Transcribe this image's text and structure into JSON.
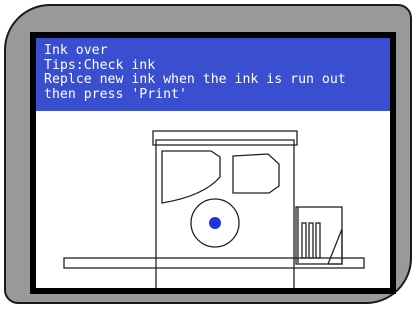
{
  "message": {
    "title": "Ink over",
    "tip": "Tips:Check ink",
    "line1": "Replce new ink when the ink is run out",
    "line2": "then press 'Print'"
  },
  "colors": {
    "message_bg": "#3a4fcf",
    "message_text": "#ffffff",
    "bezel": "#999999",
    "screen_border": "#000000",
    "indicator_dot": "#2233dd",
    "line_art": "#222222"
  },
  "icons": {
    "illustration": "printer-illustration",
    "indicator": "ink-indicator-dot-icon",
    "paper_guide": "paper-tray-icon"
  }
}
